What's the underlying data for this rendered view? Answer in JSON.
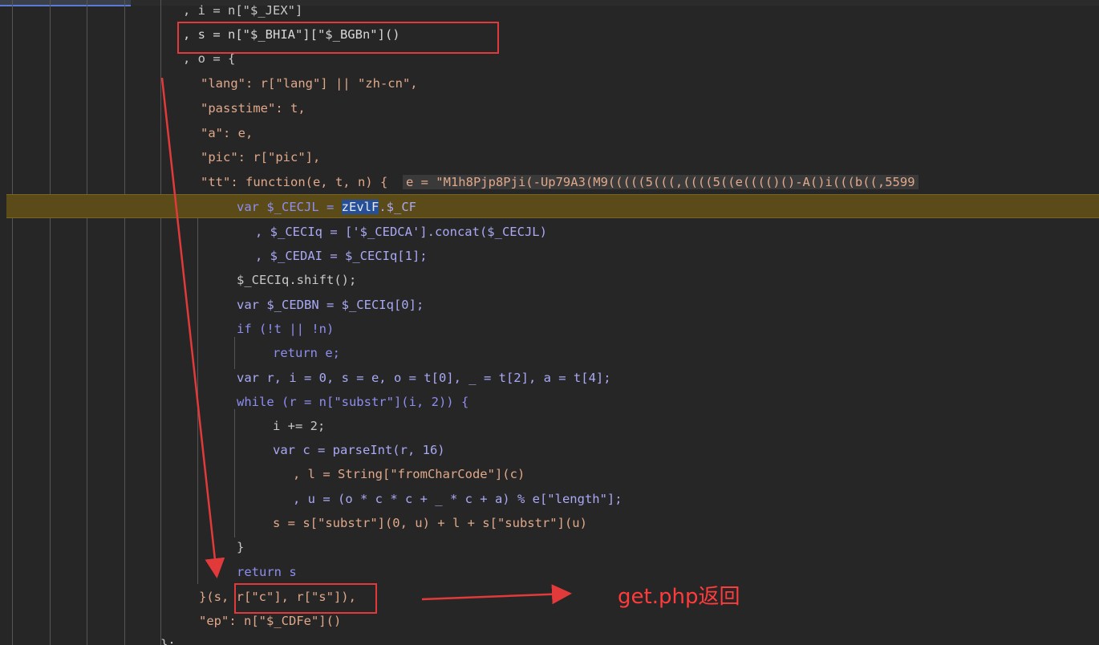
{
  "annotation": {
    "label": "get.php返回",
    "color": "#e23a3a"
  },
  "code_lines": [
    ", i = n[\"$_JEX\"]",
    ", s = n[\"$_BHIA\"][\"$_BGBn\"]()",
    ", o = {",
    "\"lang\": r[\"lang\"] || \"zh-cn\",",
    "\"passtime\": t,",
    "\"a\": e,",
    "\"pic\": r[\"pic\"],",
    "\"tt\": function(e, t, n) {",
    "e = \"M1h8Pjp8Pji(-Up79A3(M9(((((5(((,((((5((e(((()()-A()i(((b((,5599",
    "var $_CECJL = ",
    "zEvlF",
    ".$_CF",
    ", $_CECIq = ['$_CEDCA'].concat($_CECJL)",
    ", $_CEDAI = $_CECIq[1];",
    "$_CECIq.shift();",
    "var $_CEDBN = $_CECIq[0];",
    "if (!t || !n)",
    "return e;",
    "var r, i = 0, s = e, o = t[0], _ = t[2], a = t[4];",
    "while (r = n[\"substr\"](i, 2)) {",
    "i += 2;",
    "var c = parseInt(r, 16)",
    ", l = String[\"fromCharCode\"](c)",
    ", u = (o * c * c + _ * c + a) % e[\"length\"];",
    "s = s[\"substr\"](0, u) + l + s[\"substr\"](u)",
    "}",
    "return s",
    "}(s, r[\"c\"], r[\"s\"]),",
    "\"ep\": n[\"$_CDFe\"]()",
    "};"
  ]
}
